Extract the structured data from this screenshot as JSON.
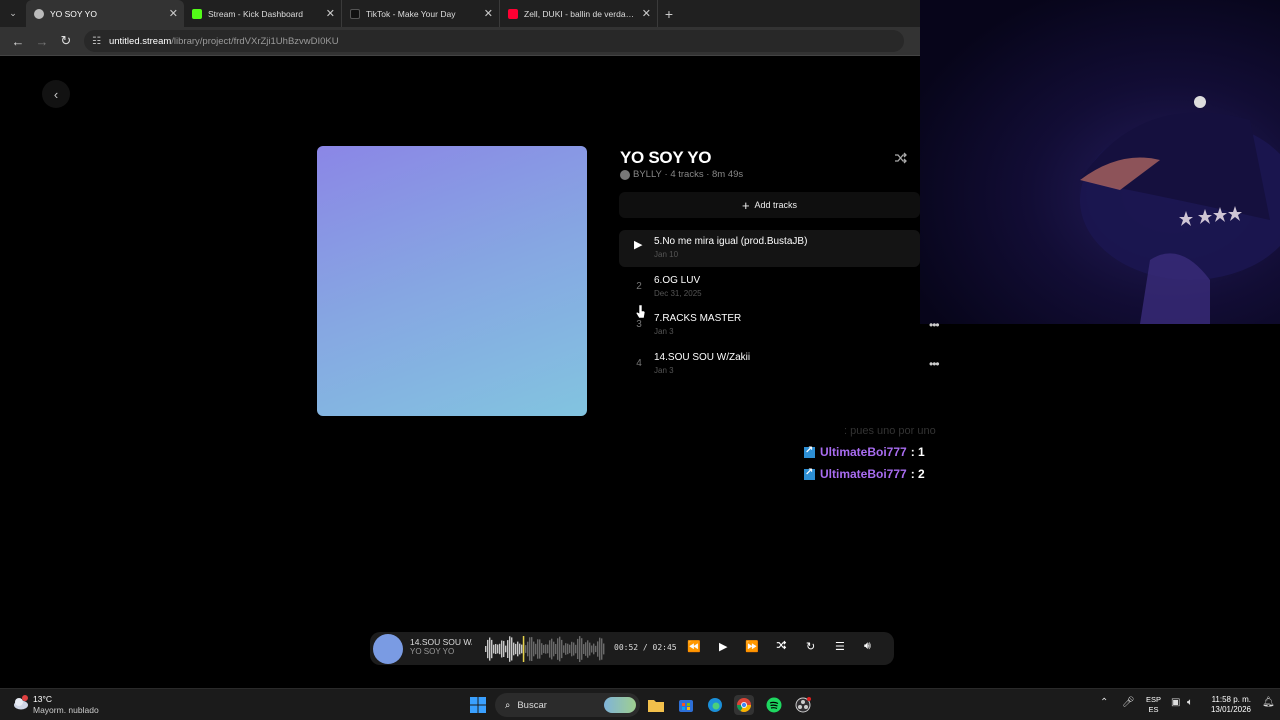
{
  "browser": {
    "tabs": [
      {
        "title": "YO SOY YO",
        "active": true,
        "favicon_color": "#bbbbbb"
      },
      {
        "title": "Stream - Kick Dashboard",
        "active": false,
        "favicon_color": "#53fc18"
      },
      {
        "title": "TikTok - Make Your Day",
        "active": false,
        "favicon_color": "#111111"
      },
      {
        "title": "Zell, DUKI - ballin de verdad (pr",
        "active": false,
        "favicon_color": "#ff0033"
      }
    ],
    "address": {
      "host": "untitled.stream",
      "path": "/library/project/frdVXrZji1UhBzvwDI0KU"
    }
  },
  "project": {
    "title": "YO SOY YO",
    "owner": "BYLLY",
    "meta": "· 4 tracks · 8m 49s",
    "add_tracks_label": "Add tracks",
    "cover_colors": [
      "#8b86e6",
      "#82c4e0"
    ]
  },
  "tracks": [
    {
      "number": "1",
      "title": "5.No me mira igual (prod.BustaJB)",
      "date": "Jan 10"
    },
    {
      "number": "2",
      "title": "6.OG LUV",
      "date": "Dec 31, 2025"
    },
    {
      "number": "3",
      "title": "7.RACKS MASTER",
      "date": "Jan 3"
    },
    {
      "number": "4",
      "title": "14.SOU SOU W/Zakii",
      "date": "Jan 3"
    }
  ],
  "chat": {
    "faded": ": pues uno por uno",
    "messages": [
      {
        "user": "UltimateBoi777",
        "text": ": 1"
      },
      {
        "user": "UltimateBoi777",
        "text": ": 2"
      }
    ]
  },
  "player": {
    "title": "14.SOU SOU W/Zakii",
    "subtitle": "YO SOY YO",
    "time": "00:52 / 02:45",
    "progress": 0.315
  },
  "taskbar": {
    "weather_temp": "13°C",
    "weather_desc": "Mayorm. nublado",
    "search_placeholder": "Buscar",
    "lang_top": "ESP",
    "lang_bottom": "ES",
    "time": "11:58 p. m.",
    "date": "13/01/2026"
  }
}
